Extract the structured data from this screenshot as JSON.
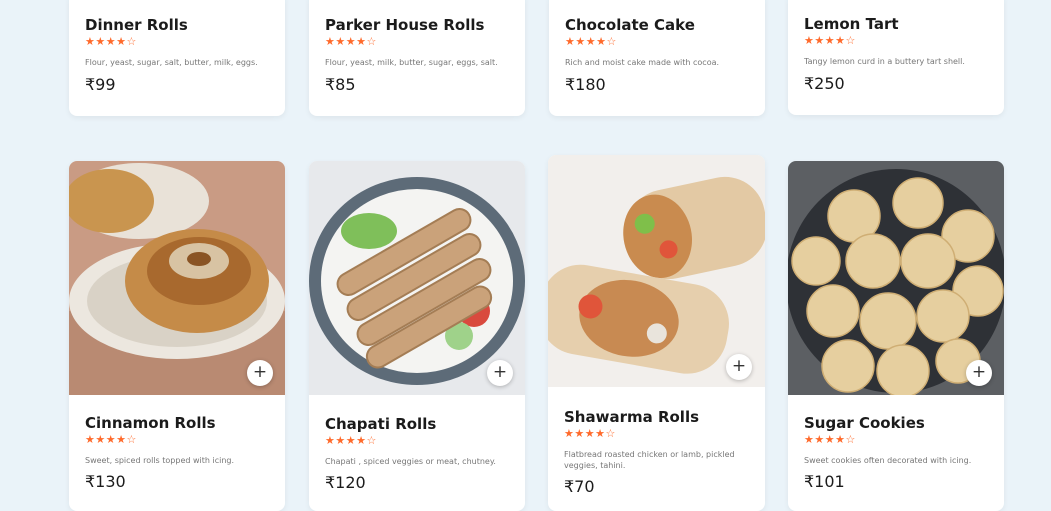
{
  "currency_symbol": "₹",
  "rating_icon": "star-icon",
  "add_icon_glyph": "+",
  "colors": {
    "page_bg": "#eaf3f9",
    "card_bg": "#ffffff",
    "star": "#ff6a2b",
    "text": "#1b1b1b",
    "muted": "#777777"
  },
  "top_row": [
    {
      "name": "Dinner Rolls",
      "rating": "★★★★☆",
      "description": "Flour, yeast, sugar, salt, butter, milk, eggs.",
      "price": "₹99"
    },
    {
      "name": "Parker House Rolls",
      "rating": "★★★★☆",
      "description": "Flour, yeast, milk, butter, sugar, eggs, salt.",
      "price": "₹85"
    },
    {
      "name": "Chocolate Cake",
      "rating": "★★★★☆",
      "description": "Rich and moist cake made with cocoa.",
      "price": "₹180"
    },
    {
      "name": "Lemon Tart",
      "rating": "★★★★☆",
      "description": "Tangy lemon curd in a buttery tart shell.",
      "price": "₹250"
    }
  ],
  "bottom_row": [
    {
      "name": "Cinnamon Rolls",
      "rating": "★★★★☆",
      "description": "Sweet, spiced rolls topped with icing.",
      "price": "₹130",
      "add_label": "+"
    },
    {
      "name": "Chapati Rolls",
      "rating": "★★★★☆",
      "description": "Chapati , spiced veggies or meat, chutney.",
      "price": "₹120",
      "add_label": "+"
    },
    {
      "name": "Shawarma Rolls",
      "rating": "★★★★☆",
      "description": "Flatbread roasted chicken or lamb, pickled veggies, tahini.",
      "price": "₹70",
      "add_label": "+"
    },
    {
      "name": "Sugar Cookies",
      "rating": "★★★★☆",
      "description": "Sweet cookies often decorated with icing.",
      "price": "₹101",
      "add_label": "+"
    }
  ]
}
